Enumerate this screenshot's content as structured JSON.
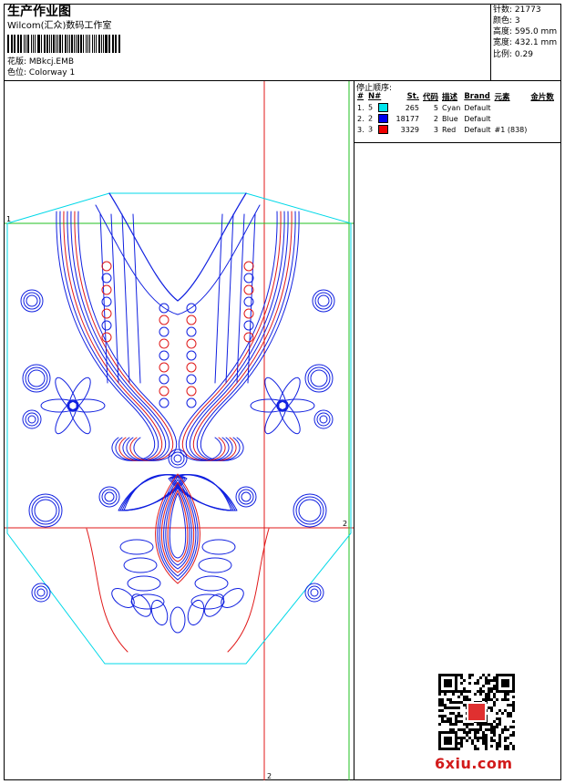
{
  "header": {
    "title": "生产作业图",
    "studio": "Wilcom(汇众)数码工作室",
    "design_label": "花版:",
    "design_value": "MBkcj.EMB",
    "colorway_label": "色位:",
    "colorway_value": "Colorway 1"
  },
  "info": {
    "stitches": {
      "label": "针数:",
      "value": "21773"
    },
    "colors": {
      "label": "颜色:",
      "value": "3"
    },
    "height": {
      "label": "高度:",
      "value": "595.0 mm"
    },
    "width": {
      "label": "宽度:",
      "value": "432.1 mm"
    },
    "scale": {
      "label": "比例:",
      "value": "0.29"
    }
  },
  "stop_sequence": {
    "title": "停止顺序:",
    "headers": [
      "#",
      "N#",
      "St.",
      "代码",
      "描述",
      "Brand",
      "元素",
      "金片数"
    ],
    "rows": [
      {
        "num": "1.",
        "n": "5",
        "color": "#00e5ee",
        "st": "265",
        "code": "5",
        "desc": "Cyan",
        "brand": "Default",
        "elem": "",
        "sequins": ""
      },
      {
        "num": "2.",
        "n": "2",
        "color": "#0000ee",
        "st": "18177",
        "code": "2",
        "desc": "Blue",
        "brand": "Default",
        "elem": "",
        "sequins": ""
      },
      {
        "num": "3.",
        "n": "3",
        "color": "#ee0000",
        "st": "3329",
        "code": "3",
        "desc": "Red",
        "brand": "Default",
        "elem": "#1 (838)",
        "sequins": ""
      }
    ]
  },
  "canvas": {
    "marker_1": "1",
    "marker_2_right": "2",
    "marker_2_bottom": "2",
    "thread_colors": {
      "cyan": "#00d8e8",
      "blue": "#1020e0",
      "red": "#e01818",
      "green": "#20c020"
    }
  },
  "footer": {
    "logo": "6xiu.com"
  }
}
